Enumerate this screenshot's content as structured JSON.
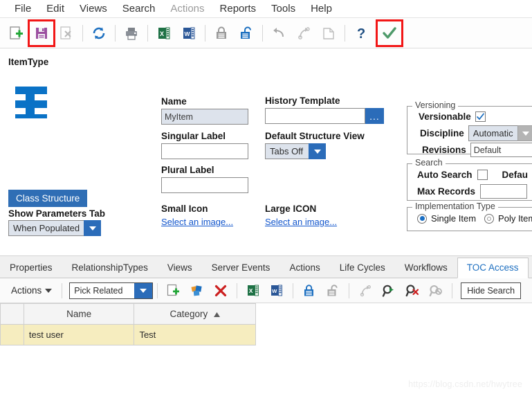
{
  "menubar": {
    "items": [
      {
        "label": "File",
        "disabled": false
      },
      {
        "label": "Edit",
        "disabled": false
      },
      {
        "label": "Views",
        "disabled": false
      },
      {
        "label": "Search",
        "disabled": false
      },
      {
        "label": "Actions",
        "disabled": true
      },
      {
        "label": "Reports",
        "disabled": false
      },
      {
        "label": "Tools",
        "disabled": false
      },
      {
        "label": "Help",
        "disabled": false
      }
    ]
  },
  "toolbar": {
    "items": [
      {
        "name": "new-icon",
        "title": "New"
      },
      {
        "name": "save-icon",
        "title": "Save",
        "highlighted": true
      },
      {
        "name": "delete-icon",
        "title": "Delete"
      },
      {
        "name": "refresh-icon",
        "title": "Refresh"
      },
      {
        "name": "print-icon",
        "title": "Print"
      },
      {
        "name": "excel-export-icon",
        "title": "Export to Excel"
      },
      {
        "name": "word-export-icon",
        "title": "Export to Word"
      },
      {
        "name": "lock-icon",
        "title": "Lock"
      },
      {
        "name": "unlock-icon",
        "title": "Unlock"
      },
      {
        "name": "undo-icon",
        "title": "Undo"
      },
      {
        "name": "redo-icon",
        "title": "Redo"
      },
      {
        "name": "copy-icon",
        "title": "Copy"
      },
      {
        "name": "help-icon",
        "title": "Help"
      },
      {
        "name": "done-check-icon",
        "title": "Done",
        "highlighted": true
      }
    ],
    "highlight_color": "#f21616"
  },
  "form": {
    "item_type_title": "ItemType",
    "item_icon_color": "#0a72c6",
    "class_structure_button": "Class Structure",
    "show_parameters_tab_label": "Show Parameters Tab",
    "show_parameters_tab_value": "When Populated",
    "name_label": "Name",
    "name_value": "MyItem",
    "singular_label": "Singular Label",
    "singular_value": "",
    "plural_label": "Plural Label",
    "plural_value": "",
    "small_icon_label": "Small Icon",
    "small_icon_link": "Select an image...",
    "history_template_label": "History Template",
    "history_template_value": "",
    "history_template_browse": "...",
    "default_structure_view_label": "Default Structure View",
    "default_structure_view_value": "Tabs Off",
    "large_icon_label": "Large ICON",
    "large_icon_link": "Select an image..."
  },
  "versioning": {
    "title": "Versioning",
    "versionable_label": "Versionable",
    "versionable_checked": true,
    "discipline_label": "Discipline",
    "discipline_value": "Automatic",
    "revisions_label": "Revisions",
    "revisions_value": "Default"
  },
  "search": {
    "title": "Search",
    "auto_search_label": "Auto Search",
    "auto_search_checked": false,
    "default_label": "Defau",
    "max_records_label": "Max Records",
    "max_records_value": ""
  },
  "implementation": {
    "title": "Implementation Type",
    "single_item_label": "Single Item",
    "single_item_selected": true,
    "poly_item_label": "Poly Item",
    "poly_item_selected": false
  },
  "tabs": {
    "items": [
      {
        "label": "Properties",
        "active": false
      },
      {
        "label": "RelationshipTypes",
        "active": false
      },
      {
        "label": "Views",
        "active": false
      },
      {
        "label": "Server Events",
        "active": false
      },
      {
        "label": "Actions",
        "active": false
      },
      {
        "label": "Life Cycles",
        "active": false
      },
      {
        "label": "Workflows",
        "active": false
      },
      {
        "label": "TOC Access",
        "active": true
      }
    ],
    "active_color": "#1d6fc0"
  },
  "actionbar": {
    "actions_label": "Actions",
    "pick_related_value": "Pick Related",
    "hide_search_label": "Hide Search",
    "icons": [
      {
        "name": "add-row-icon",
        "title": "Create New"
      },
      {
        "name": "pick-items-icon",
        "title": "Pick Items"
      },
      {
        "name": "delete-row-icon",
        "title": "Delete"
      },
      {
        "name": "excel-export-icon",
        "title": "Export to Excel"
      },
      {
        "name": "word-export-icon",
        "title": "Export to Word"
      },
      {
        "name": "lock-icon",
        "title": "Lock"
      },
      {
        "name": "unlock-icon",
        "title": "Unlock"
      },
      {
        "name": "redo-icon",
        "title": "Redo"
      },
      {
        "name": "run-search-icon",
        "title": "Run Search"
      },
      {
        "name": "clear-search-icon",
        "title": "Clear Search"
      },
      {
        "name": "disable-search-icon",
        "title": "Disable Search"
      }
    ]
  },
  "grid": {
    "columns": [
      "",
      "Name",
      "Category"
    ],
    "sort_column": "Category",
    "sort_direction": "asc",
    "rows": [
      {
        "selected": true,
        "name": "test user",
        "category": "Test"
      }
    ]
  },
  "watermark": "https://blog.csdn.net/hwytree"
}
